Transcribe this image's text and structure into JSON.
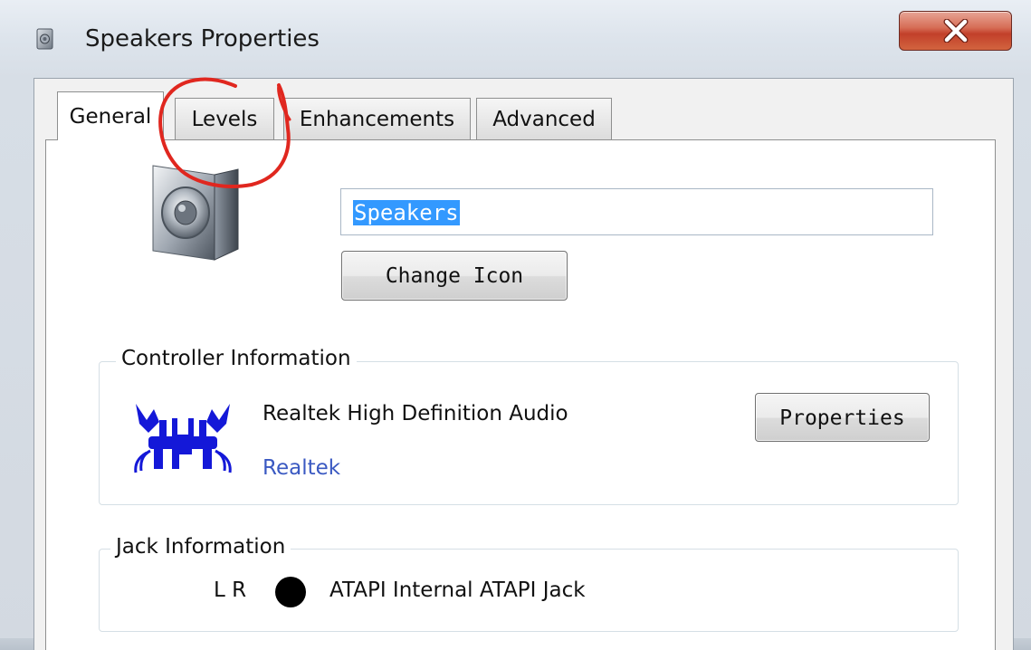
{
  "window": {
    "title": "Speakers Properties",
    "close_glyph": "X"
  },
  "tabs": [
    {
      "label": "General",
      "active": true
    },
    {
      "label": "Levels",
      "active": false
    },
    {
      "label": "Enhancements",
      "active": false
    },
    {
      "label": "Advanced",
      "active": false
    }
  ],
  "general": {
    "device_name_value": "Speakers",
    "change_icon_label": "Change Icon",
    "device_icon": "speaker-icon"
  },
  "controller": {
    "group_label": "Controller Information",
    "device": "Realtek High Definition Audio",
    "vendor_link": "Realtek",
    "properties_label": "Properties",
    "logo": "realtek-crab-logo"
  },
  "jack": {
    "group_label": "Jack Information",
    "channels": "L R",
    "description": "ATAPI Internal ATAPI Jack",
    "color": "#000000"
  },
  "annotation": {
    "shape": "hand-drawn circle",
    "color": "#e0271f",
    "target": "tab-levels"
  },
  "colors": {
    "close_button": "#c9442c",
    "selection": "#3399ff",
    "link": "#3a59c2"
  }
}
